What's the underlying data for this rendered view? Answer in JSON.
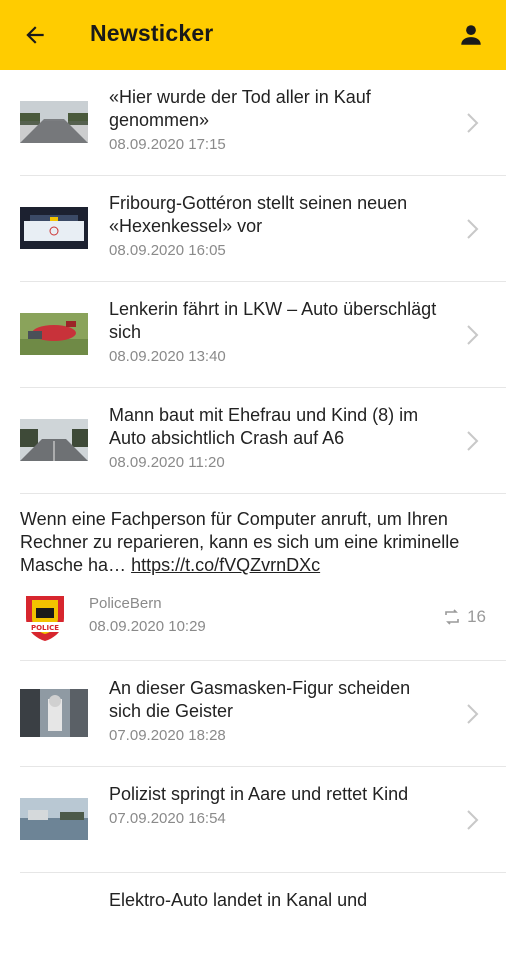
{
  "header": {
    "title": "Newsticker",
    "back_icon": "arrow-left-icon",
    "user_icon": "user-icon",
    "color": "#ffcc00"
  },
  "items": [
    {
      "headline": "«Hier wurde der Tod aller in Kauf genommen»",
      "date": "08.09.2020 17:15"
    },
    {
      "headline": "Fribourg-Gottéron stellt seinen neuen «Hexenkessel» vor",
      "date": "08.09.2020 16:05"
    },
    {
      "headline": "Lenkerin fährt in LKW – Auto überschlägt sich",
      "date": "08.09.2020 13:40"
    },
    {
      "headline": "Mann baut mit Ehefrau und Kind (8) im Auto absichtlich Crash auf A6",
      "date": "08.09.2020 11:20"
    }
  ],
  "tweet": {
    "text": "Wenn eine Fachperson für Computer anruft, um Ihren Rechner zu reparieren, kann es sich um eine kriminelle Masche ha… ",
    "link": "https://t.co/fVQZvrnDXc",
    "author": "PoliceBern",
    "date": "08.09.2020 10:29",
    "retweets": "16",
    "logo_text": "POLICE"
  },
  "items2": [
    {
      "headline": "An dieser Gasmasken-Figur scheiden sich die Geister",
      "date": "07.09.2020 18:28"
    },
    {
      "headline": "Polizist springt in Aare und rettet Kind",
      "date": "07.09.2020 16:54"
    },
    {
      "headline": "Elektro-Auto landet in Kanal und",
      "date": ""
    }
  ]
}
